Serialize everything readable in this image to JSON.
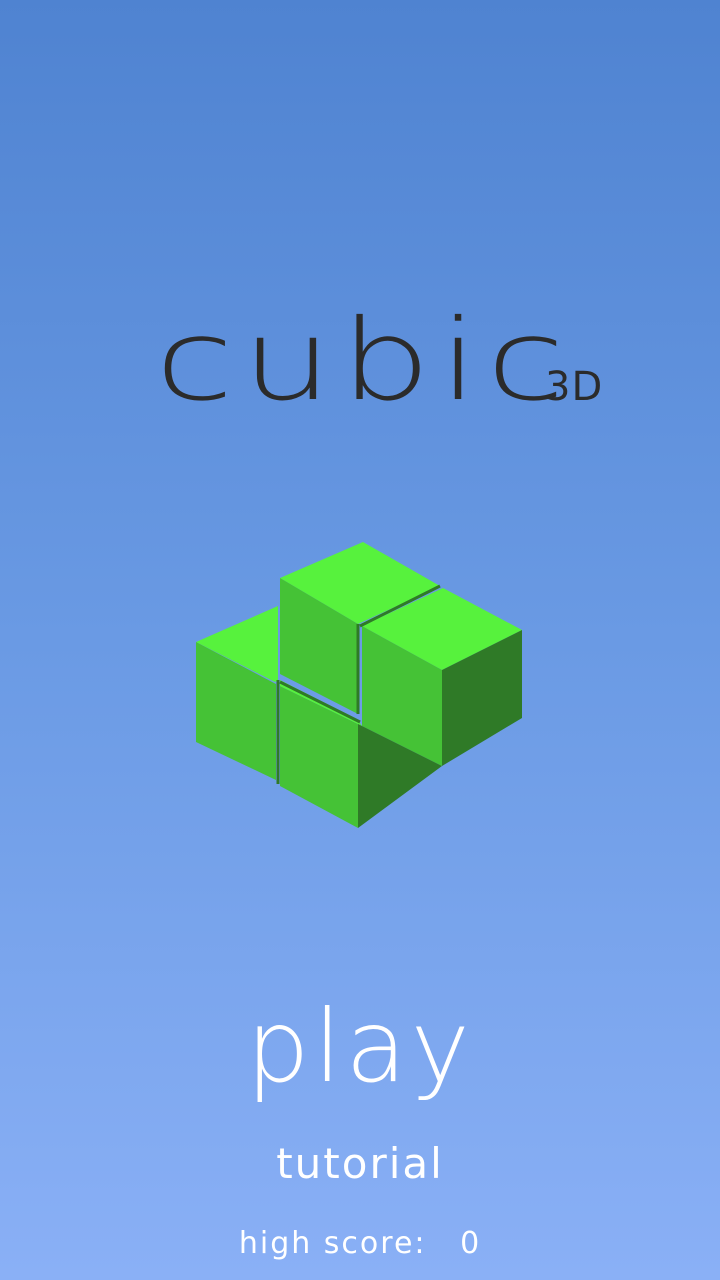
{
  "title": {
    "main": "cubic",
    "sub": "3D"
  },
  "logo": {
    "icon": "green-cube-cluster-icon",
    "colors": {
      "top": "#57f23d",
      "left": "#45c236",
      "right": "#2f7a27"
    }
  },
  "menu": {
    "play_label": "play",
    "tutorial_label": "tutorial"
  },
  "score": {
    "label": "high score:",
    "value": "0"
  },
  "background": {
    "top": "#4f83d1",
    "bottom": "#8ab0f6"
  }
}
